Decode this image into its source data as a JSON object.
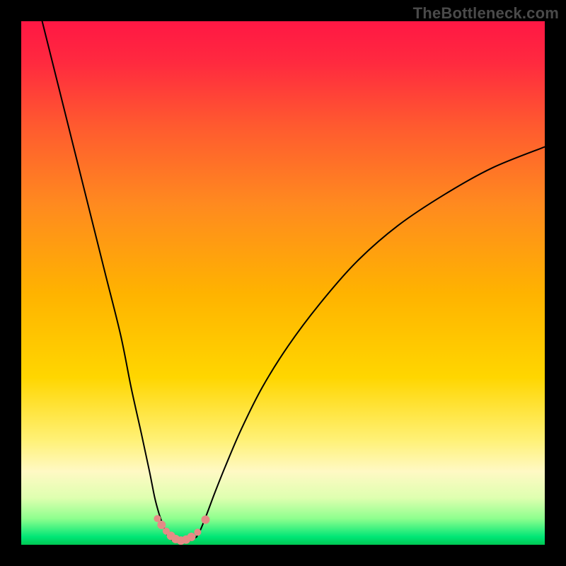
{
  "watermark": "TheBottleneck.com",
  "chart_data": {
    "type": "line",
    "title": "",
    "xlabel": "",
    "ylabel": "",
    "xlim": [
      0,
      100
    ],
    "ylim": [
      0,
      100
    ],
    "background_gradient": {
      "stops": [
        {
          "pos": 0.0,
          "color": "#ff1744"
        },
        {
          "pos": 0.08,
          "color": "#ff2a3f"
        },
        {
          "pos": 0.2,
          "color": "#ff5a2f"
        },
        {
          "pos": 0.35,
          "color": "#ff8a1f"
        },
        {
          "pos": 0.52,
          "color": "#ffb300"
        },
        {
          "pos": 0.68,
          "color": "#ffd600"
        },
        {
          "pos": 0.8,
          "color": "#fff176"
        },
        {
          "pos": 0.86,
          "color": "#fff9c4"
        },
        {
          "pos": 0.91,
          "color": "#dfffb0"
        },
        {
          "pos": 0.95,
          "color": "#8eff8e"
        },
        {
          "pos": 0.985,
          "color": "#00e676"
        },
        {
          "pos": 1.0,
          "color": "#00c853"
        }
      ]
    },
    "series": [
      {
        "name": "left-branch",
        "x": [
          4,
          7,
          10,
          13,
          16,
          19,
          21,
          23,
          24.5,
          25.5,
          26.3,
          27,
          27.6,
          28.1
        ],
        "y": [
          100,
          88,
          76,
          64,
          52,
          40,
          30,
          21,
          14,
          9,
          6,
          4,
          2.5,
          1.5
        ]
      },
      {
        "name": "right-branch",
        "x": [
          33.5,
          34.3,
          35.5,
          37,
          39,
          42,
          46,
          51,
          57,
          64,
          72,
          81,
          90,
          100
        ],
        "y": [
          1.5,
          3,
          6,
          10,
          15,
          22,
          30,
          38,
          46,
          54,
          61,
          67,
          72,
          76
        ]
      },
      {
        "name": "valley-floor",
        "x": [
          28.1,
          28.8,
          29.6,
          30.5,
          31.5,
          32.5,
          33.5
        ],
        "y": [
          1.5,
          0.9,
          0.6,
          0.5,
          0.6,
          0.9,
          1.5
        ]
      }
    ],
    "markers": {
      "name": "valley-dots",
      "color": "#e58b86",
      "points": [
        {
          "x": 26.0,
          "y": 5.0,
          "r": 5
        },
        {
          "x": 26.8,
          "y": 3.8,
          "r": 6
        },
        {
          "x": 27.7,
          "y": 2.6,
          "r": 5
        },
        {
          "x": 28.6,
          "y": 1.7,
          "r": 6
        },
        {
          "x": 29.5,
          "y": 1.1,
          "r": 6
        },
        {
          "x": 30.5,
          "y": 0.8,
          "r": 6
        },
        {
          "x": 31.5,
          "y": 1.0,
          "r": 6
        },
        {
          "x": 32.5,
          "y": 1.5,
          "r": 6
        },
        {
          "x": 33.7,
          "y": 2.4,
          "r": 5
        },
        {
          "x": 35.2,
          "y": 4.8,
          "r": 6
        }
      ]
    }
  }
}
